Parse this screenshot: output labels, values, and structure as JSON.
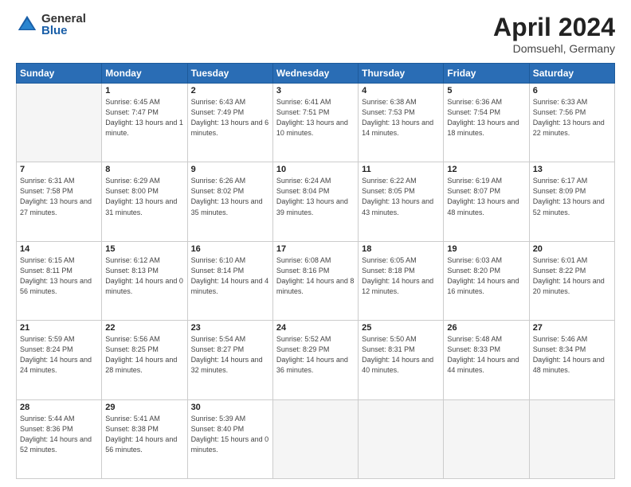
{
  "header": {
    "logo_general": "General",
    "logo_blue": "Blue",
    "month_title": "April 2024",
    "location": "Domsuehl, Germany"
  },
  "weekdays": [
    "Sunday",
    "Monday",
    "Tuesday",
    "Wednesday",
    "Thursday",
    "Friday",
    "Saturday"
  ],
  "weeks": [
    [
      {
        "day": "",
        "empty": true
      },
      {
        "day": "1",
        "sunrise": "Sunrise: 6:45 AM",
        "sunset": "Sunset: 7:47 PM",
        "daylight": "Daylight: 13 hours and 1 minute."
      },
      {
        "day": "2",
        "sunrise": "Sunrise: 6:43 AM",
        "sunset": "Sunset: 7:49 PM",
        "daylight": "Daylight: 13 hours and 6 minutes."
      },
      {
        "day": "3",
        "sunrise": "Sunrise: 6:41 AM",
        "sunset": "Sunset: 7:51 PM",
        "daylight": "Daylight: 13 hours and 10 minutes."
      },
      {
        "day": "4",
        "sunrise": "Sunrise: 6:38 AM",
        "sunset": "Sunset: 7:53 PM",
        "daylight": "Daylight: 13 hours and 14 minutes."
      },
      {
        "day": "5",
        "sunrise": "Sunrise: 6:36 AM",
        "sunset": "Sunset: 7:54 PM",
        "daylight": "Daylight: 13 hours and 18 minutes."
      },
      {
        "day": "6",
        "sunrise": "Sunrise: 6:33 AM",
        "sunset": "Sunset: 7:56 PM",
        "daylight": "Daylight: 13 hours and 22 minutes."
      }
    ],
    [
      {
        "day": "7",
        "sunrise": "Sunrise: 6:31 AM",
        "sunset": "Sunset: 7:58 PM",
        "daylight": "Daylight: 13 hours and 27 minutes."
      },
      {
        "day": "8",
        "sunrise": "Sunrise: 6:29 AM",
        "sunset": "Sunset: 8:00 PM",
        "daylight": "Daylight: 13 hours and 31 minutes."
      },
      {
        "day": "9",
        "sunrise": "Sunrise: 6:26 AM",
        "sunset": "Sunset: 8:02 PM",
        "daylight": "Daylight: 13 hours and 35 minutes."
      },
      {
        "day": "10",
        "sunrise": "Sunrise: 6:24 AM",
        "sunset": "Sunset: 8:04 PM",
        "daylight": "Daylight: 13 hours and 39 minutes."
      },
      {
        "day": "11",
        "sunrise": "Sunrise: 6:22 AM",
        "sunset": "Sunset: 8:05 PM",
        "daylight": "Daylight: 13 hours and 43 minutes."
      },
      {
        "day": "12",
        "sunrise": "Sunrise: 6:19 AM",
        "sunset": "Sunset: 8:07 PM",
        "daylight": "Daylight: 13 hours and 48 minutes."
      },
      {
        "day": "13",
        "sunrise": "Sunrise: 6:17 AM",
        "sunset": "Sunset: 8:09 PM",
        "daylight": "Daylight: 13 hours and 52 minutes."
      }
    ],
    [
      {
        "day": "14",
        "sunrise": "Sunrise: 6:15 AM",
        "sunset": "Sunset: 8:11 PM",
        "daylight": "Daylight: 13 hours and 56 minutes."
      },
      {
        "day": "15",
        "sunrise": "Sunrise: 6:12 AM",
        "sunset": "Sunset: 8:13 PM",
        "daylight": "Daylight: 14 hours and 0 minutes."
      },
      {
        "day": "16",
        "sunrise": "Sunrise: 6:10 AM",
        "sunset": "Sunset: 8:14 PM",
        "daylight": "Daylight: 14 hours and 4 minutes."
      },
      {
        "day": "17",
        "sunrise": "Sunrise: 6:08 AM",
        "sunset": "Sunset: 8:16 PM",
        "daylight": "Daylight: 14 hours and 8 minutes."
      },
      {
        "day": "18",
        "sunrise": "Sunrise: 6:05 AM",
        "sunset": "Sunset: 8:18 PM",
        "daylight": "Daylight: 14 hours and 12 minutes."
      },
      {
        "day": "19",
        "sunrise": "Sunrise: 6:03 AM",
        "sunset": "Sunset: 8:20 PM",
        "daylight": "Daylight: 14 hours and 16 minutes."
      },
      {
        "day": "20",
        "sunrise": "Sunrise: 6:01 AM",
        "sunset": "Sunset: 8:22 PM",
        "daylight": "Daylight: 14 hours and 20 minutes."
      }
    ],
    [
      {
        "day": "21",
        "sunrise": "Sunrise: 5:59 AM",
        "sunset": "Sunset: 8:24 PM",
        "daylight": "Daylight: 14 hours and 24 minutes."
      },
      {
        "day": "22",
        "sunrise": "Sunrise: 5:56 AM",
        "sunset": "Sunset: 8:25 PM",
        "daylight": "Daylight: 14 hours and 28 minutes."
      },
      {
        "day": "23",
        "sunrise": "Sunrise: 5:54 AM",
        "sunset": "Sunset: 8:27 PM",
        "daylight": "Daylight: 14 hours and 32 minutes."
      },
      {
        "day": "24",
        "sunrise": "Sunrise: 5:52 AM",
        "sunset": "Sunset: 8:29 PM",
        "daylight": "Daylight: 14 hours and 36 minutes."
      },
      {
        "day": "25",
        "sunrise": "Sunrise: 5:50 AM",
        "sunset": "Sunset: 8:31 PM",
        "daylight": "Daylight: 14 hours and 40 minutes."
      },
      {
        "day": "26",
        "sunrise": "Sunrise: 5:48 AM",
        "sunset": "Sunset: 8:33 PM",
        "daylight": "Daylight: 14 hours and 44 minutes."
      },
      {
        "day": "27",
        "sunrise": "Sunrise: 5:46 AM",
        "sunset": "Sunset: 8:34 PM",
        "daylight": "Daylight: 14 hours and 48 minutes."
      }
    ],
    [
      {
        "day": "28",
        "sunrise": "Sunrise: 5:44 AM",
        "sunset": "Sunset: 8:36 PM",
        "daylight": "Daylight: 14 hours and 52 minutes."
      },
      {
        "day": "29",
        "sunrise": "Sunrise: 5:41 AM",
        "sunset": "Sunset: 8:38 PM",
        "daylight": "Daylight: 14 hours and 56 minutes."
      },
      {
        "day": "30",
        "sunrise": "Sunrise: 5:39 AM",
        "sunset": "Sunset: 8:40 PM",
        "daylight": "Daylight: 15 hours and 0 minutes."
      },
      {
        "day": "",
        "empty": true
      },
      {
        "day": "",
        "empty": true
      },
      {
        "day": "",
        "empty": true
      },
      {
        "day": "",
        "empty": true
      }
    ]
  ]
}
